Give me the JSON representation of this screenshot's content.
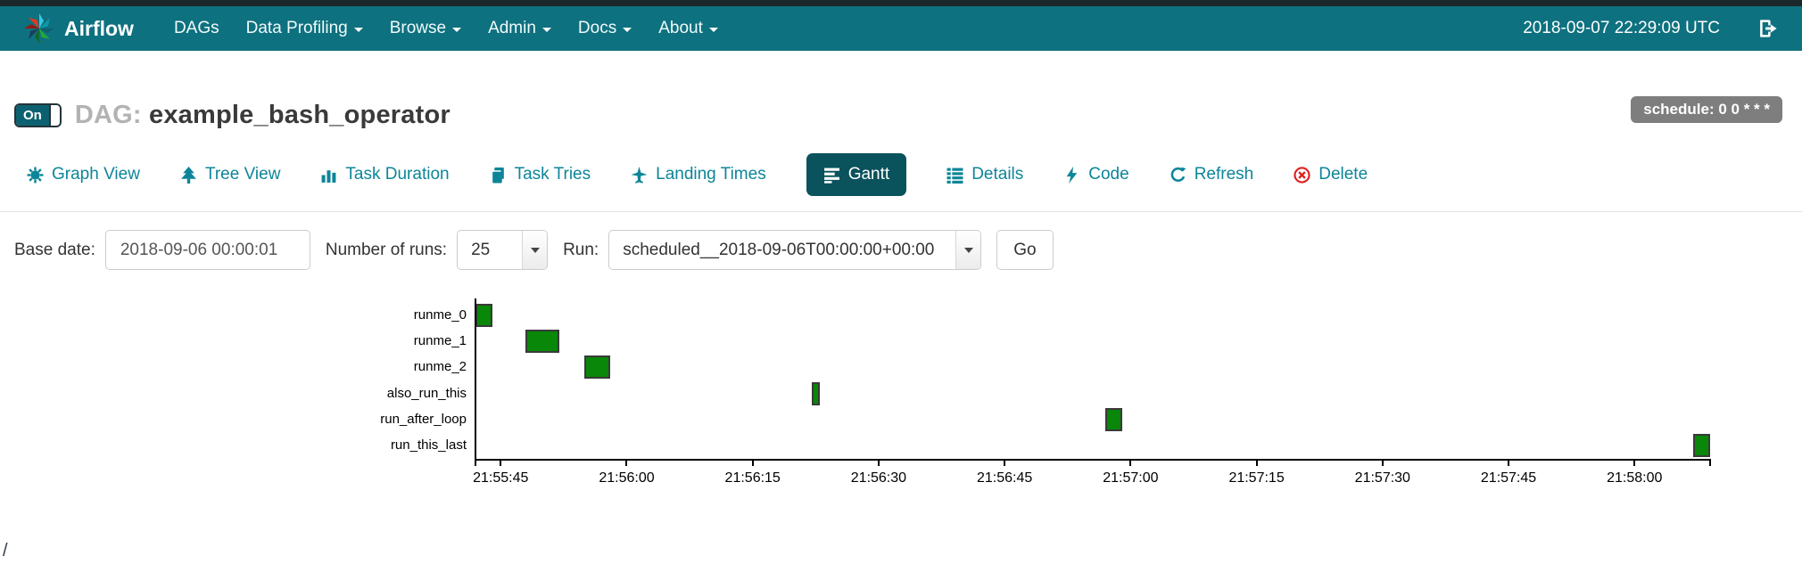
{
  "navbar": {
    "brand": "Airflow",
    "items": [
      {
        "label": "DAGs",
        "caret": false
      },
      {
        "label": "Data Profiling",
        "caret": true
      },
      {
        "label": "Browse",
        "caret": true
      },
      {
        "label": "Admin",
        "caret": true
      },
      {
        "label": "Docs",
        "caret": true
      },
      {
        "label": "About",
        "caret": true
      }
    ],
    "clock": "2018-09-07 22:29:09 UTC",
    "colors": {
      "navbar_bg": "#0e717f",
      "top_strip": "#1b272a"
    }
  },
  "dag_header": {
    "toggle_label": "On",
    "dag_prefix": "DAG:",
    "dag_name": "example_bash_operator",
    "schedule_badge": "schedule: 0 0 * * *",
    "badge_color": "#7e7e7e"
  },
  "tabs": {
    "active_bg": "#0a525c",
    "link_color": "#0d8599",
    "delete_icon_color": "#dc1f1f",
    "items": [
      {
        "label": "Graph View",
        "icon": "burst-icon",
        "active": false
      },
      {
        "label": "Tree View",
        "icon": "tree-icon",
        "active": false
      },
      {
        "label": "Task Duration",
        "icon": "bar-chart-icon",
        "active": false
      },
      {
        "label": "Task Tries",
        "icon": "pages-icon",
        "active": false
      },
      {
        "label": "Landing Times",
        "icon": "plane-icon",
        "active": false
      },
      {
        "label": "Gantt",
        "icon": "align-left-icon",
        "active": true
      },
      {
        "label": "Details",
        "icon": "list-icon",
        "active": false
      },
      {
        "label": "Code",
        "icon": "bolt-icon",
        "active": false
      },
      {
        "label": "Refresh",
        "icon": "refresh-icon",
        "active": false
      },
      {
        "label": "Delete",
        "icon": "circle-x-icon",
        "active": false
      }
    ]
  },
  "filter_form": {
    "base_date_label": "Base date:",
    "base_date_value": "2018-09-06 00:00:01",
    "num_runs_label": "Number of runs:",
    "num_runs_value": "25",
    "run_label": "Run:",
    "run_value": "scheduled__2018-09-06T00:00:00+00:00",
    "go_label": "Go"
  },
  "chart_data": {
    "type": "gantt",
    "title": "",
    "tasks": [
      "runme_0",
      "runme_1",
      "runme_2",
      "also_run_this",
      "run_after_loop",
      "run_this_last"
    ],
    "bars": [
      {
        "task": "runme_0",
        "start": "21:55:42",
        "end": "21:55:44"
      },
      {
        "task": "runme_1",
        "start": "21:55:48",
        "end": "21:55:52"
      },
      {
        "task": "runme_2",
        "start": "21:55:55",
        "end": "21:55:58"
      },
      {
        "task": "also_run_this",
        "start": "21:56:22",
        "end": "21:56:23"
      },
      {
        "task": "run_after_loop",
        "start": "21:56:57",
        "end": "21:56:59"
      },
      {
        "task": "run_this_last",
        "start": "21:58:07",
        "end": "21:58:09"
      }
    ],
    "x_ticks": [
      "21:55:45",
      "21:56:00",
      "21:56:15",
      "21:56:30",
      "21:56:45",
      "21:57:00",
      "21:57:15",
      "21:57:30",
      "21:57:45",
      "21:58:00"
    ],
    "x_range": [
      "21:55:42",
      "21:58:09"
    ],
    "bar_color": "#088708",
    "grid": false,
    "legend": false
  },
  "footer": {
    "text": "/"
  }
}
